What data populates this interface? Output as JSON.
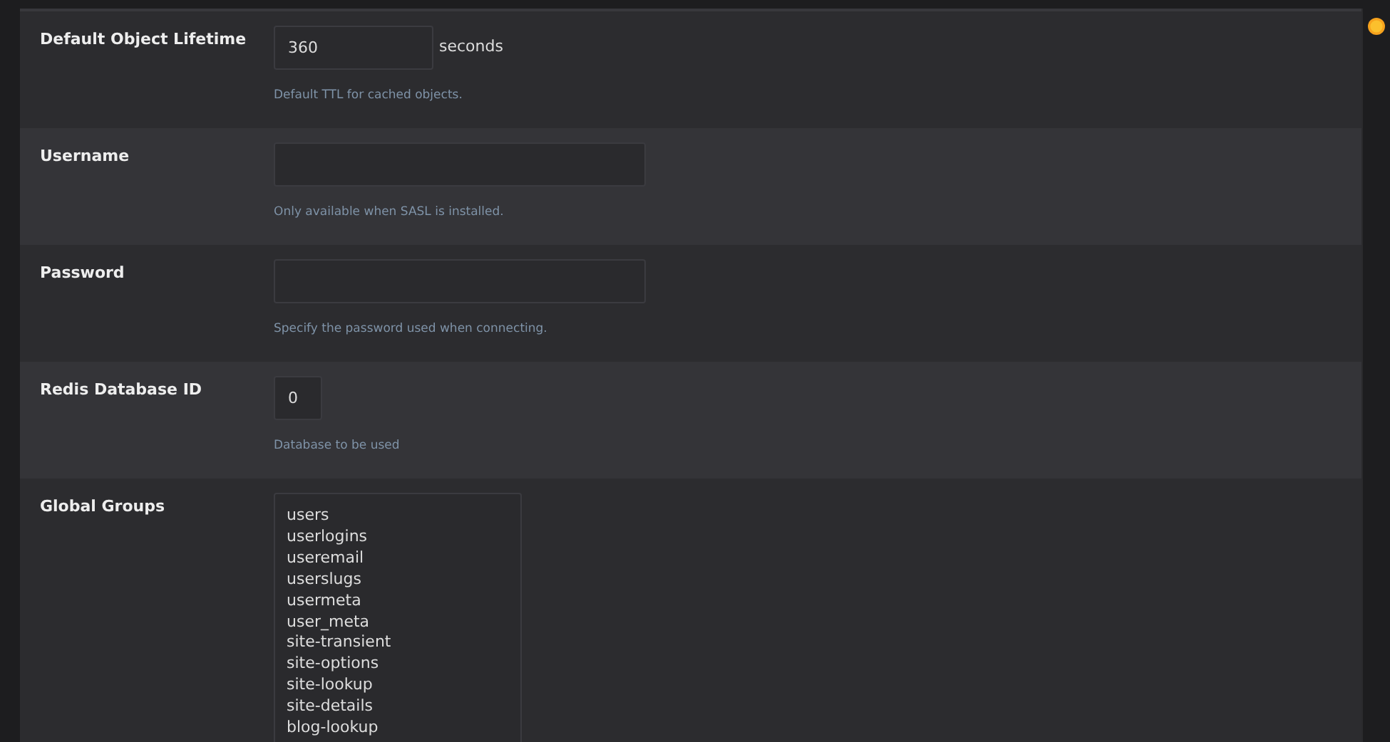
{
  "settings": [
    {
      "kind": "duration",
      "label": "Default Object Lifetime",
      "value": "360",
      "suffix": "seconds",
      "hint": "Default TTL for cached objects."
    },
    {
      "kind": "text",
      "label": "Username",
      "hint": "Only available when SASL is installed."
    },
    {
      "kind": "password",
      "label": "Password",
      "hint": "Specify the password used when connecting."
    },
    {
      "kind": "number",
      "label": "Redis Database ID",
      "value": "0",
      "hint": "Database to be used"
    },
    {
      "kind": "textarea",
      "label": "Global Groups",
      "lines": [
        "users",
        "userlogins",
        "useremail",
        "userslugs",
        "usermeta",
        "user_meta",
        "site-transient",
        "site-options",
        "site-lookup",
        "site-details",
        "blog-lookup"
      ]
    }
  ]
}
